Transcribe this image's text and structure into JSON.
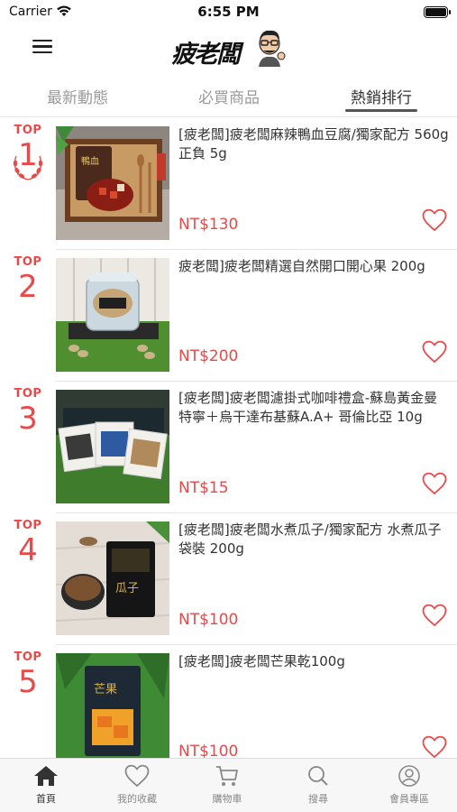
{
  "status_bar": {
    "carrier": "Carrier",
    "time": "6:55 PM"
  },
  "header": {
    "logo_text": "疲老闆",
    "menu_icon": "hamburger-menu-icon"
  },
  "tabs": [
    {
      "label": "最新動態",
      "active": false
    },
    {
      "label": "必買商品",
      "active": false
    },
    {
      "label": "熱銷排行",
      "active": true
    }
  ],
  "ranking": {
    "top_label": "TOP",
    "items": [
      {
        "rank": "1",
        "title": "[疲老闆]疲老闆麻辣鴨血豆腐/獨家配方 560g 正負 5g",
        "price": "NT$130"
      },
      {
        "rank": "2",
        "title": "疲老闆]疲老闆精選自然開口開心果 200g",
        "price": "NT$200"
      },
      {
        "rank": "3",
        "title": "[疲老闆]疲老闆濾掛式咖啡禮盒-蘇島黃金曼特寧＋烏干達布基蘇A.A+ 哥倫比亞 10g",
        "price": "NT$15"
      },
      {
        "rank": "4",
        "title": "[疲老闆]疲老闆水煮瓜子/獨家配方 水煮瓜子 袋裝 200g",
        "price": "NT$100"
      },
      {
        "rank": "5",
        "title": "[疲老闆]疲老闆芒果乾100g",
        "price": "NT$100"
      }
    ]
  },
  "bottom_nav": [
    {
      "label": "首頁",
      "icon": "home-icon",
      "active": true
    },
    {
      "label": "我的收藏",
      "icon": "heart-icon",
      "active": false
    },
    {
      "label": "購物車",
      "icon": "cart-icon",
      "active": false
    },
    {
      "label": "搜尋",
      "icon": "search-icon",
      "active": false
    },
    {
      "label": "會員專區",
      "icon": "user-icon",
      "active": false
    }
  ],
  "colors": {
    "accent": "#e84a4a",
    "tab_bar_bg": "#f7f7f7"
  }
}
